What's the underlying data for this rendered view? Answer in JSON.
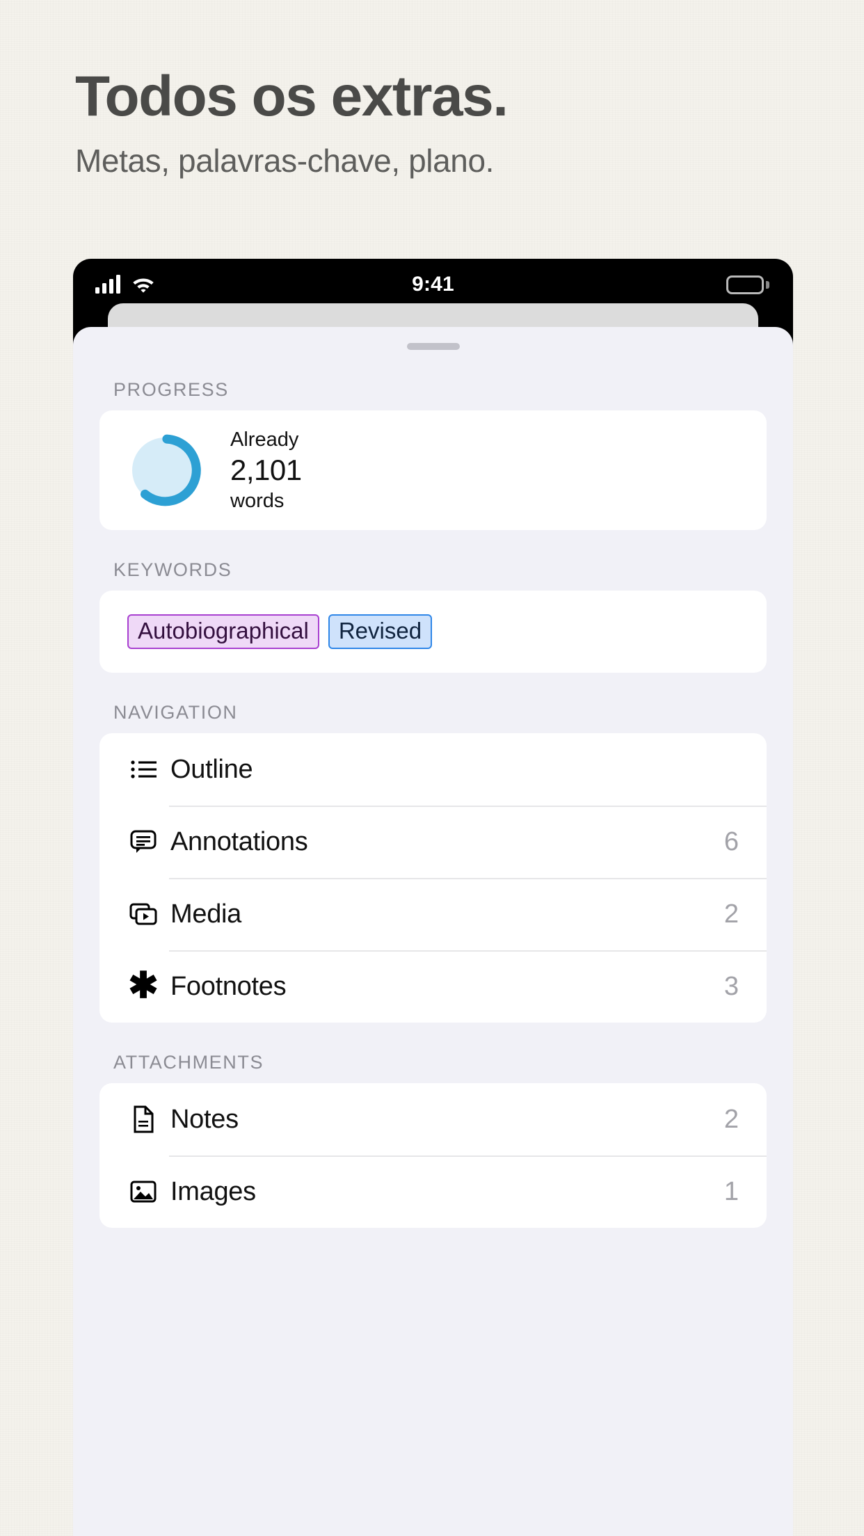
{
  "promo": {
    "title": "Todos os extras.",
    "subtitle": "Metas, palavras-chave, plano."
  },
  "statusbar": {
    "time": "9:41",
    "signal_icon": "cellular-signal-icon",
    "wifi_icon": "wifi-icon",
    "battery_icon": "battery-full-icon"
  },
  "sheet": {
    "grabber": "sheet-grabber"
  },
  "sections": {
    "progress": {
      "label": "PROGRESS",
      "already_label": "Already",
      "count": "2,101",
      "unit_label": "words",
      "ring_percent": 66,
      "ring_track_color": "#d6ecf8",
      "ring_fill_color": "#2da0d4"
    },
    "keywords": {
      "label": "KEYWORDS",
      "chips": [
        {
          "text": "Autobiographical",
          "bg": "#efd9f7",
          "border": "#a83fd0",
          "color": "#34103f"
        },
        {
          "text": "Revised",
          "bg": "#cfe2fb",
          "border": "#2e86e8",
          "color": "#10243f"
        }
      ]
    },
    "navigation": {
      "label": "NAVIGATION",
      "rows": [
        {
          "icon": "bullet-list-icon",
          "label": "Outline",
          "count": ""
        },
        {
          "icon": "comment-bubble-icon",
          "label": "Annotations",
          "count": "6"
        },
        {
          "icon": "media-stack-icon",
          "label": "Media",
          "count": "2"
        },
        {
          "icon": "asterisk-icon",
          "label": "Footnotes",
          "count": "3"
        }
      ]
    },
    "attachments": {
      "label": "ATTACHMENTS",
      "rows": [
        {
          "icon": "document-icon",
          "label": "Notes",
          "count": "2"
        },
        {
          "icon": "photo-icon",
          "label": "Images",
          "count": "1"
        }
      ]
    }
  }
}
